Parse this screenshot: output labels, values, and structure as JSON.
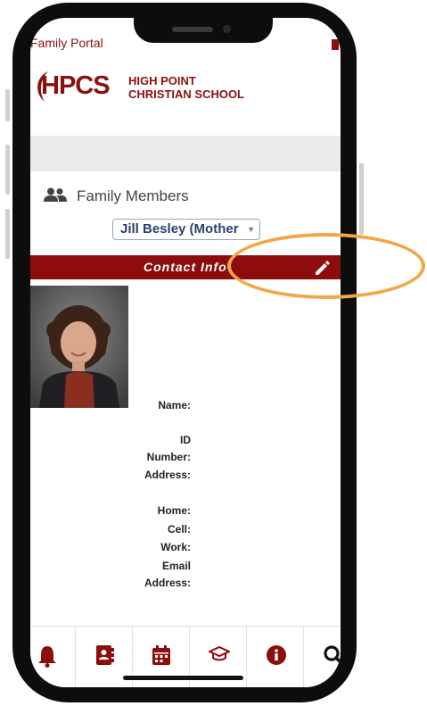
{
  "header": {
    "title": "Family Portal"
  },
  "logo": {
    "abbr": "HPCS",
    "school_line1": "HIGH POINT",
    "school_line2": "CHRISTIAN SCHOOL"
  },
  "family": {
    "section_label": "Family Members",
    "selected_member": "Jill Besley (Mother"
  },
  "contact": {
    "bar_label": "Contact Info",
    "fields": {
      "name": "Name:",
      "id_1": "ID",
      "id_2": "Number:",
      "address": "Address:",
      "home": "Home:",
      "cell": "Cell:",
      "work": "Work:",
      "email_1": "Email",
      "email_2": "Address:"
    }
  },
  "nav": {
    "items": [
      "bell-icon",
      "address-book-icon",
      "calendar-icon",
      "graduation-cap-icon",
      "info-icon",
      "search-icon"
    ]
  },
  "colors": {
    "brand": "#8d0c0c",
    "highlight": "#f3a646",
    "select_text": "#2a4170"
  }
}
